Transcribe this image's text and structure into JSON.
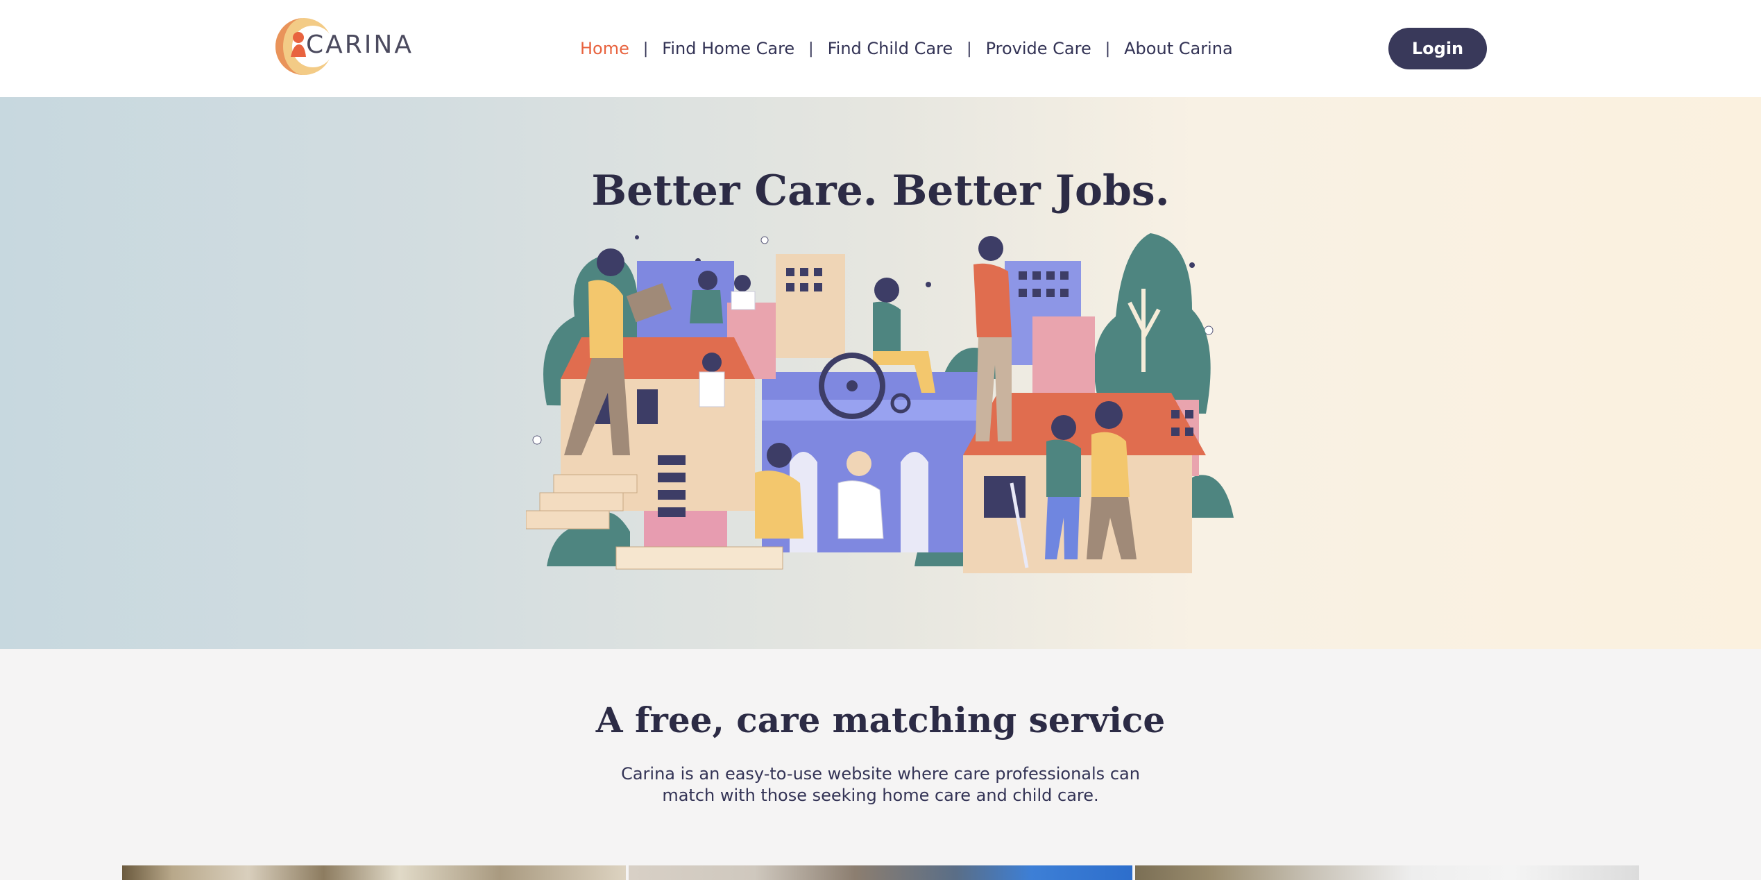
{
  "header": {
    "logo_text": "CARINA",
    "nav": [
      {
        "label": "Home",
        "active": true
      },
      {
        "label": "Find Home Care",
        "active": false
      },
      {
        "label": "Find Child Care",
        "active": false
      },
      {
        "label": "Provide Care",
        "active": false
      },
      {
        "label": "About Carina",
        "active": false
      }
    ],
    "nav_separator": "|",
    "login_label": "Login"
  },
  "hero": {
    "title": "Better Care. Better Jobs.",
    "illustration": "community-care-illustration"
  },
  "info": {
    "title": "A free, care matching service",
    "description": "Carina is an easy-to-use website where care professionals can match with those seeking home care and child care."
  },
  "photos": [
    {
      "name": "photo-garden"
    },
    {
      "name": "photo-portrait"
    },
    {
      "name": "photo-home"
    }
  ],
  "colors": {
    "accent": "#e8633f",
    "brand_dark": "#39395a",
    "text": "#333355",
    "hero_left": "#c7d8df",
    "hero_right": "#fbf1df",
    "section_bg": "#f5f4f4"
  }
}
